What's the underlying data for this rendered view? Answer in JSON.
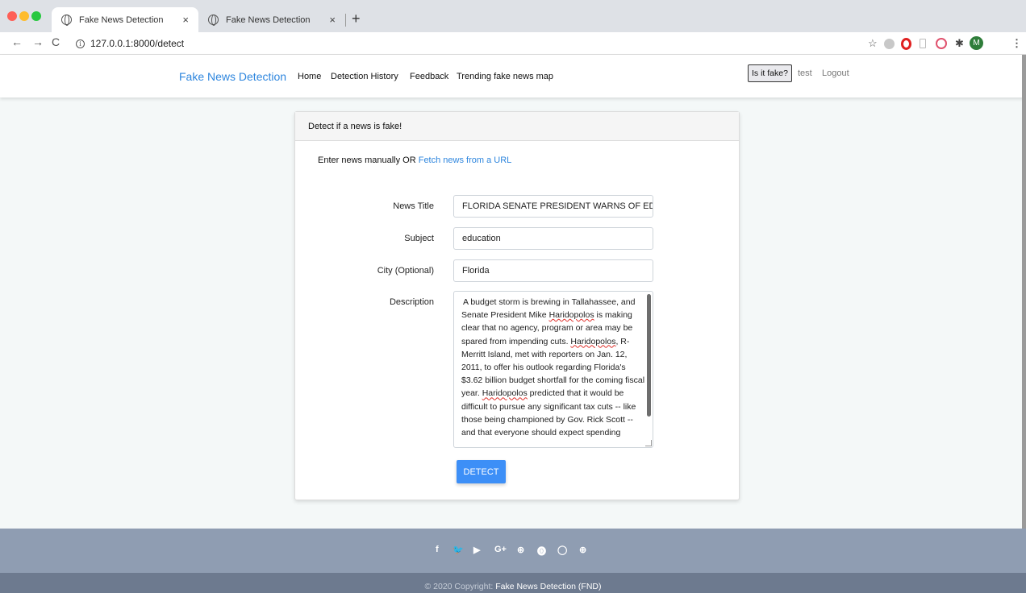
{
  "browser": {
    "tabs": [
      {
        "title": "Fake News Detection",
        "close": "×",
        "active": true
      },
      {
        "title": "Fake News Detection",
        "close": "×",
        "active": false
      }
    ],
    "new_tab": "+",
    "nav": {
      "back": "←",
      "forward": "→",
      "reload": "C"
    },
    "url": "127.0.0.1:8000/detect",
    "profile_initial": "M",
    "star": "☆",
    "menu": "⋮"
  },
  "navbar": {
    "brand": "Fake News Detection",
    "links": [
      "Home",
      "Detection History",
      "Feedback",
      "Trending fake news map"
    ],
    "is_fake_button": "Is it fake?",
    "username": "test",
    "logout": "Logout"
  },
  "card": {
    "header": "Detect if a news is fake!",
    "intro_text": "Enter news manually OR ",
    "intro_link": "Fetch news from a URL",
    "fields": {
      "title_label": "News Title",
      "title_value": "FLORIDA SENATE PRESIDENT WARNS OF ED",
      "subject_label": "Subject",
      "subject_value": "education",
      "city_label": "City (Optional)",
      "city_value": "Florida",
      "description_label": "Description",
      "description_value": "A budget storm is brewing in Tallahassee, and Senate President Mike Haridopolos is making clear that no agency, program or area may be spared from impending cuts. Haridopolos, R-Merritt Island, met with reporters on Jan. 12, 2011, to offer his outlook regarding Florida's $3.62 billion budget shortfall for the coming fiscal year. Haridopolos predicted that it would be difficult to pursue any significant tax cuts -- like those being championed by Gov. Rick Scott -- and that everyone should expect spending"
    },
    "detect_button": "DETECT"
  },
  "footer": {
    "social_icons": [
      "f",
      "🐦",
      "▶",
      "G+",
      "⊛",
      "⓿",
      "◯",
      "⊕"
    ],
    "social_names": [
      "facebook-icon",
      "twitter-icon",
      "youtube-icon",
      "google-plus-icon",
      "dribbble-icon",
      "pinterest-icon",
      "github-icon",
      "codepen-icon"
    ],
    "copyright_prefix": "© 2020 Copyright: ",
    "copyright_brand": "Fake News Detection (FND)"
  },
  "colors": {
    "brand": "#2e86de",
    "detect_button": "#3d8ff7",
    "footer_top": "#8f9db2",
    "footer_bottom": "#6d7a8f",
    "page_bg": "#f4f8f8"
  }
}
